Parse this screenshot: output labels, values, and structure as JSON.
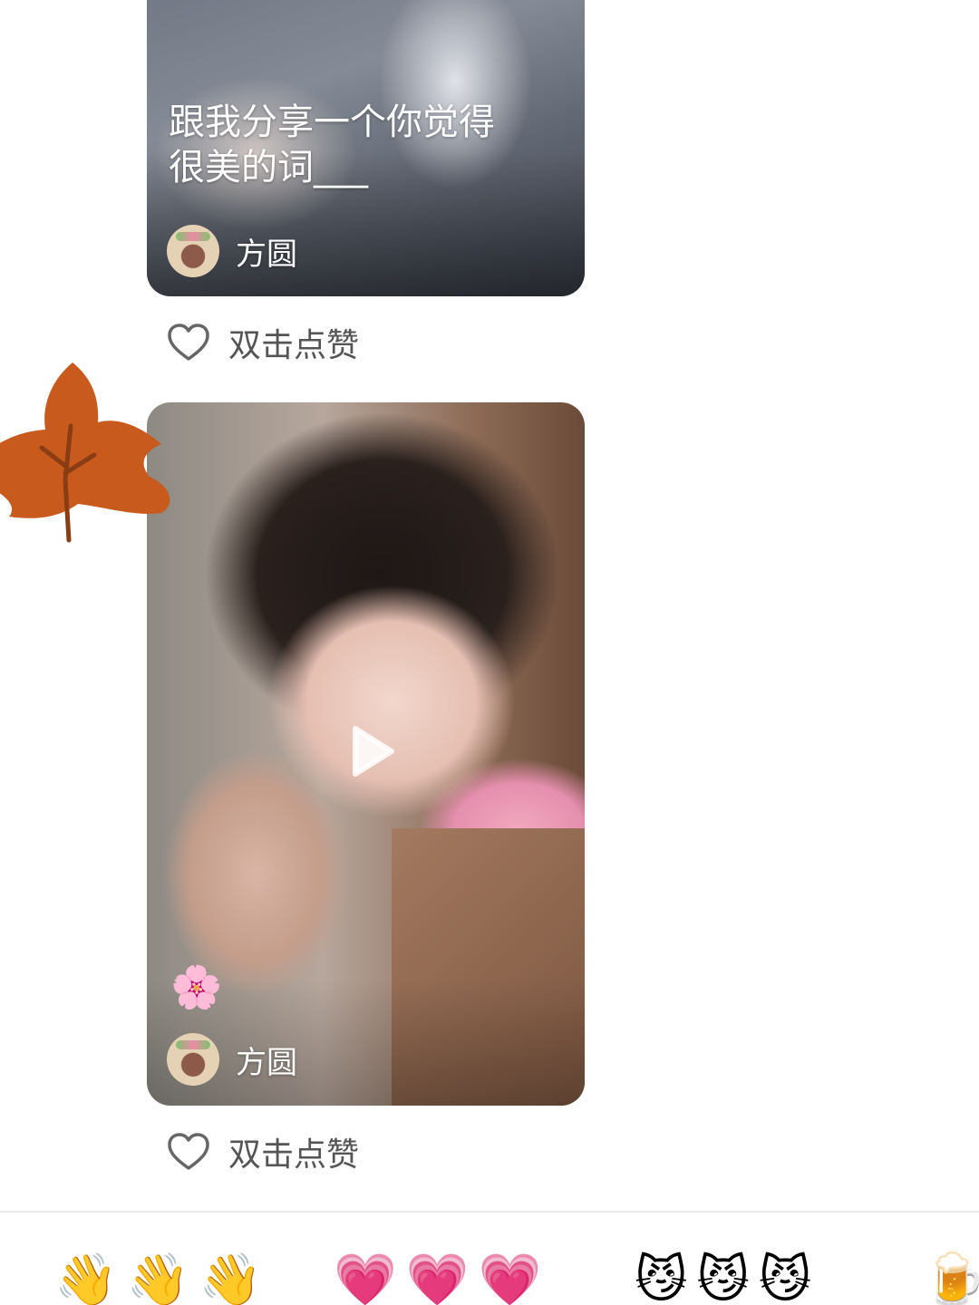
{
  "posts": [
    {
      "caption_line1": "跟我分享一个你觉得",
      "caption_line2": "很美的词___",
      "author": "方圆",
      "like_label": "双击点赞"
    },
    {
      "author": "方圆",
      "sticker": "🌸",
      "like_label": "双击点赞"
    }
  ],
  "icons": {
    "leaf": "maple-leaf-sticker",
    "play": "play-icon",
    "like": "heart-outline-icon"
  },
  "reactions": [
    {
      "emoji": "👋👋👋"
    },
    {
      "emoji": "💗💗💗"
    },
    {
      "emoji": "😼😼😼"
    },
    {
      "emoji": "🍺"
    }
  ],
  "colors": {
    "leaf": "#c85a1e",
    "like_text": "#555555",
    "divider": "#ececec"
  }
}
